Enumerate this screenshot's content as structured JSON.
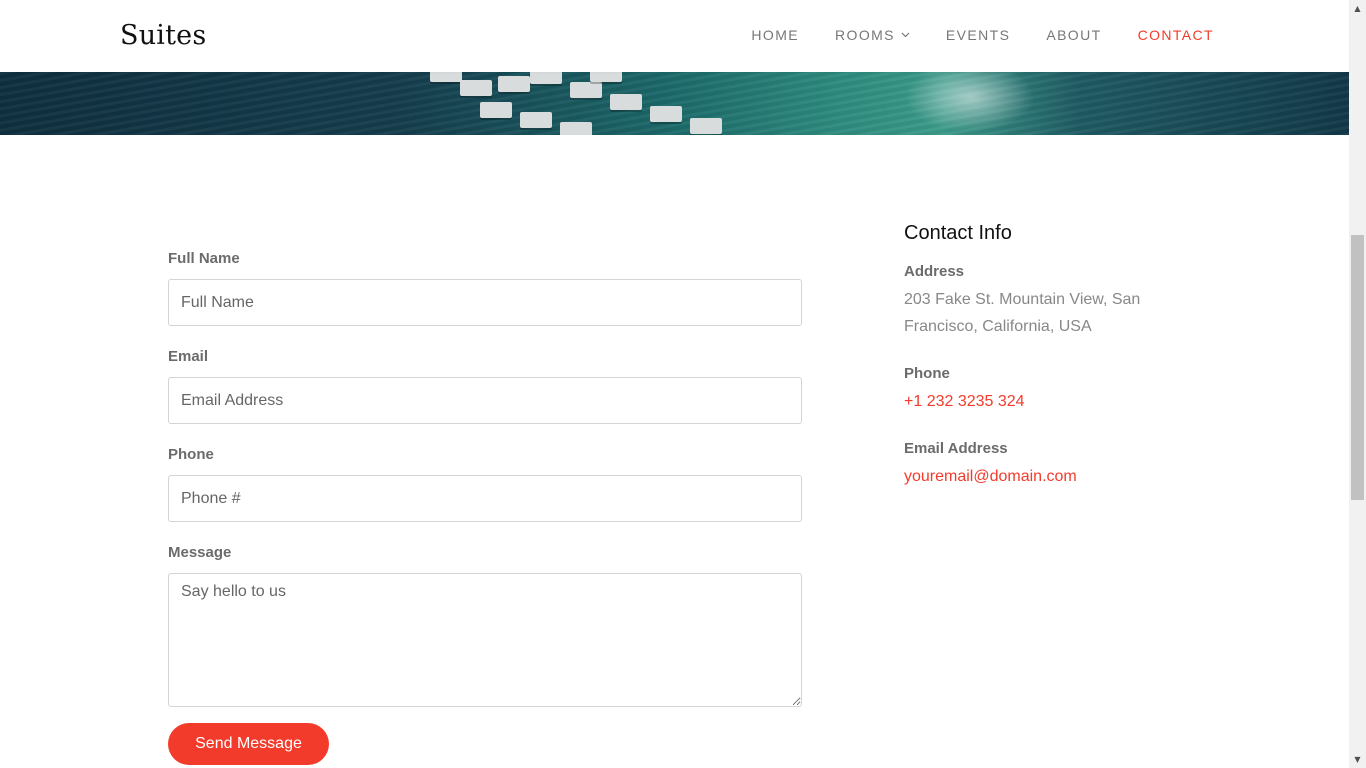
{
  "header": {
    "logo": "Suites",
    "nav": [
      {
        "label": "HOME"
      },
      {
        "label": "ROOMS"
      },
      {
        "label": "EVENTS"
      },
      {
        "label": "ABOUT"
      },
      {
        "label": "CONTACT"
      }
    ],
    "active_nav": "CONTACT"
  },
  "form": {
    "full_name": {
      "label": "Full Name",
      "placeholder": "Full Name",
      "value": ""
    },
    "email": {
      "label": "Email",
      "placeholder": "Email Address",
      "value": ""
    },
    "phone": {
      "label": "Phone",
      "placeholder": "Phone #",
      "value": ""
    },
    "message": {
      "label": "Message",
      "placeholder": "Say hello to us",
      "value": ""
    },
    "submit_label": "Send Message"
  },
  "contact_info": {
    "title": "Contact Info",
    "address_label": "Address",
    "address": "203 Fake St. Mountain View, San Francisco, California, USA",
    "phone_label": "Phone",
    "phone": "+1 232 3235 324",
    "email_label": "Email Address",
    "email": "youremail@domain.com"
  },
  "colors": {
    "accent": "#f33b2b",
    "label": "#6b6b6b",
    "muted_text": "#888888"
  },
  "icons": {
    "rooms_dropdown": "chevron-down-icon",
    "scroll_up": "triangle-up-icon",
    "scroll_down": "triangle-down-icon"
  }
}
